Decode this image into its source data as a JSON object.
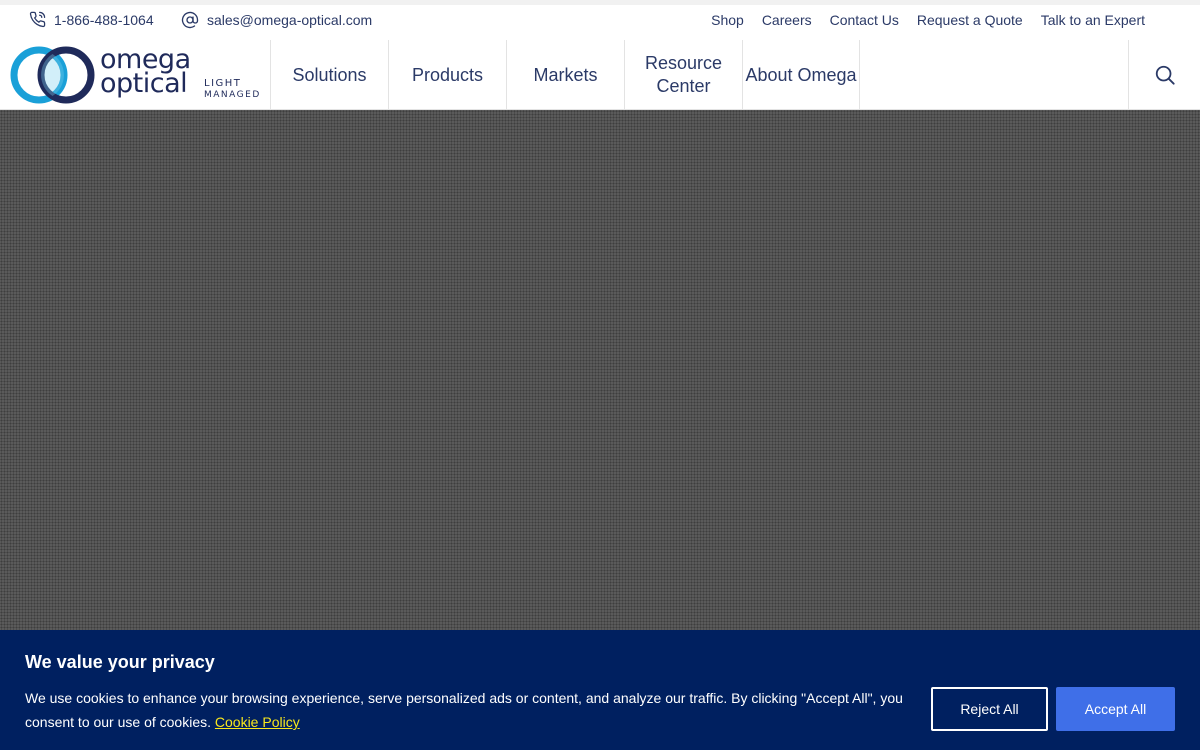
{
  "utility_bar": {
    "phone": "1-866-488-1064",
    "email": "sales@omega-optical.com",
    "links": [
      "Shop",
      "Careers",
      "Contact Us",
      "Request a Quote",
      "Talk to an Expert"
    ]
  },
  "logo": {
    "line1": "omega",
    "line2": "optical",
    "tagline1": "LIGHT",
    "tagline2": "MANAGED"
  },
  "nav": {
    "items": [
      "Solutions",
      "Products",
      "Markets",
      "Resource Center",
      "About Omega"
    ]
  },
  "cookie_banner": {
    "title": "We value your privacy",
    "text": "We use cookies to enhance your browsing experience, serve personalized ads or content, and analyze our traffic. By clicking \"Accept All\", you consent to our use of cookies.",
    "policy_link": "Cookie Policy",
    "reject_label": "Reject All",
    "accept_label": "Accept All"
  },
  "icons": {
    "phone": "phone-icon",
    "email": "at-sign-icon",
    "search": "search-icon"
  },
  "colors": {
    "brand_navy": "#1f2a5a",
    "link_text": "#2b3a67",
    "banner_bg": "#002060",
    "accept_bg": "#3f6fe8",
    "policy_link": "#f8e71c",
    "logo_blue": "#1aa0d8"
  }
}
